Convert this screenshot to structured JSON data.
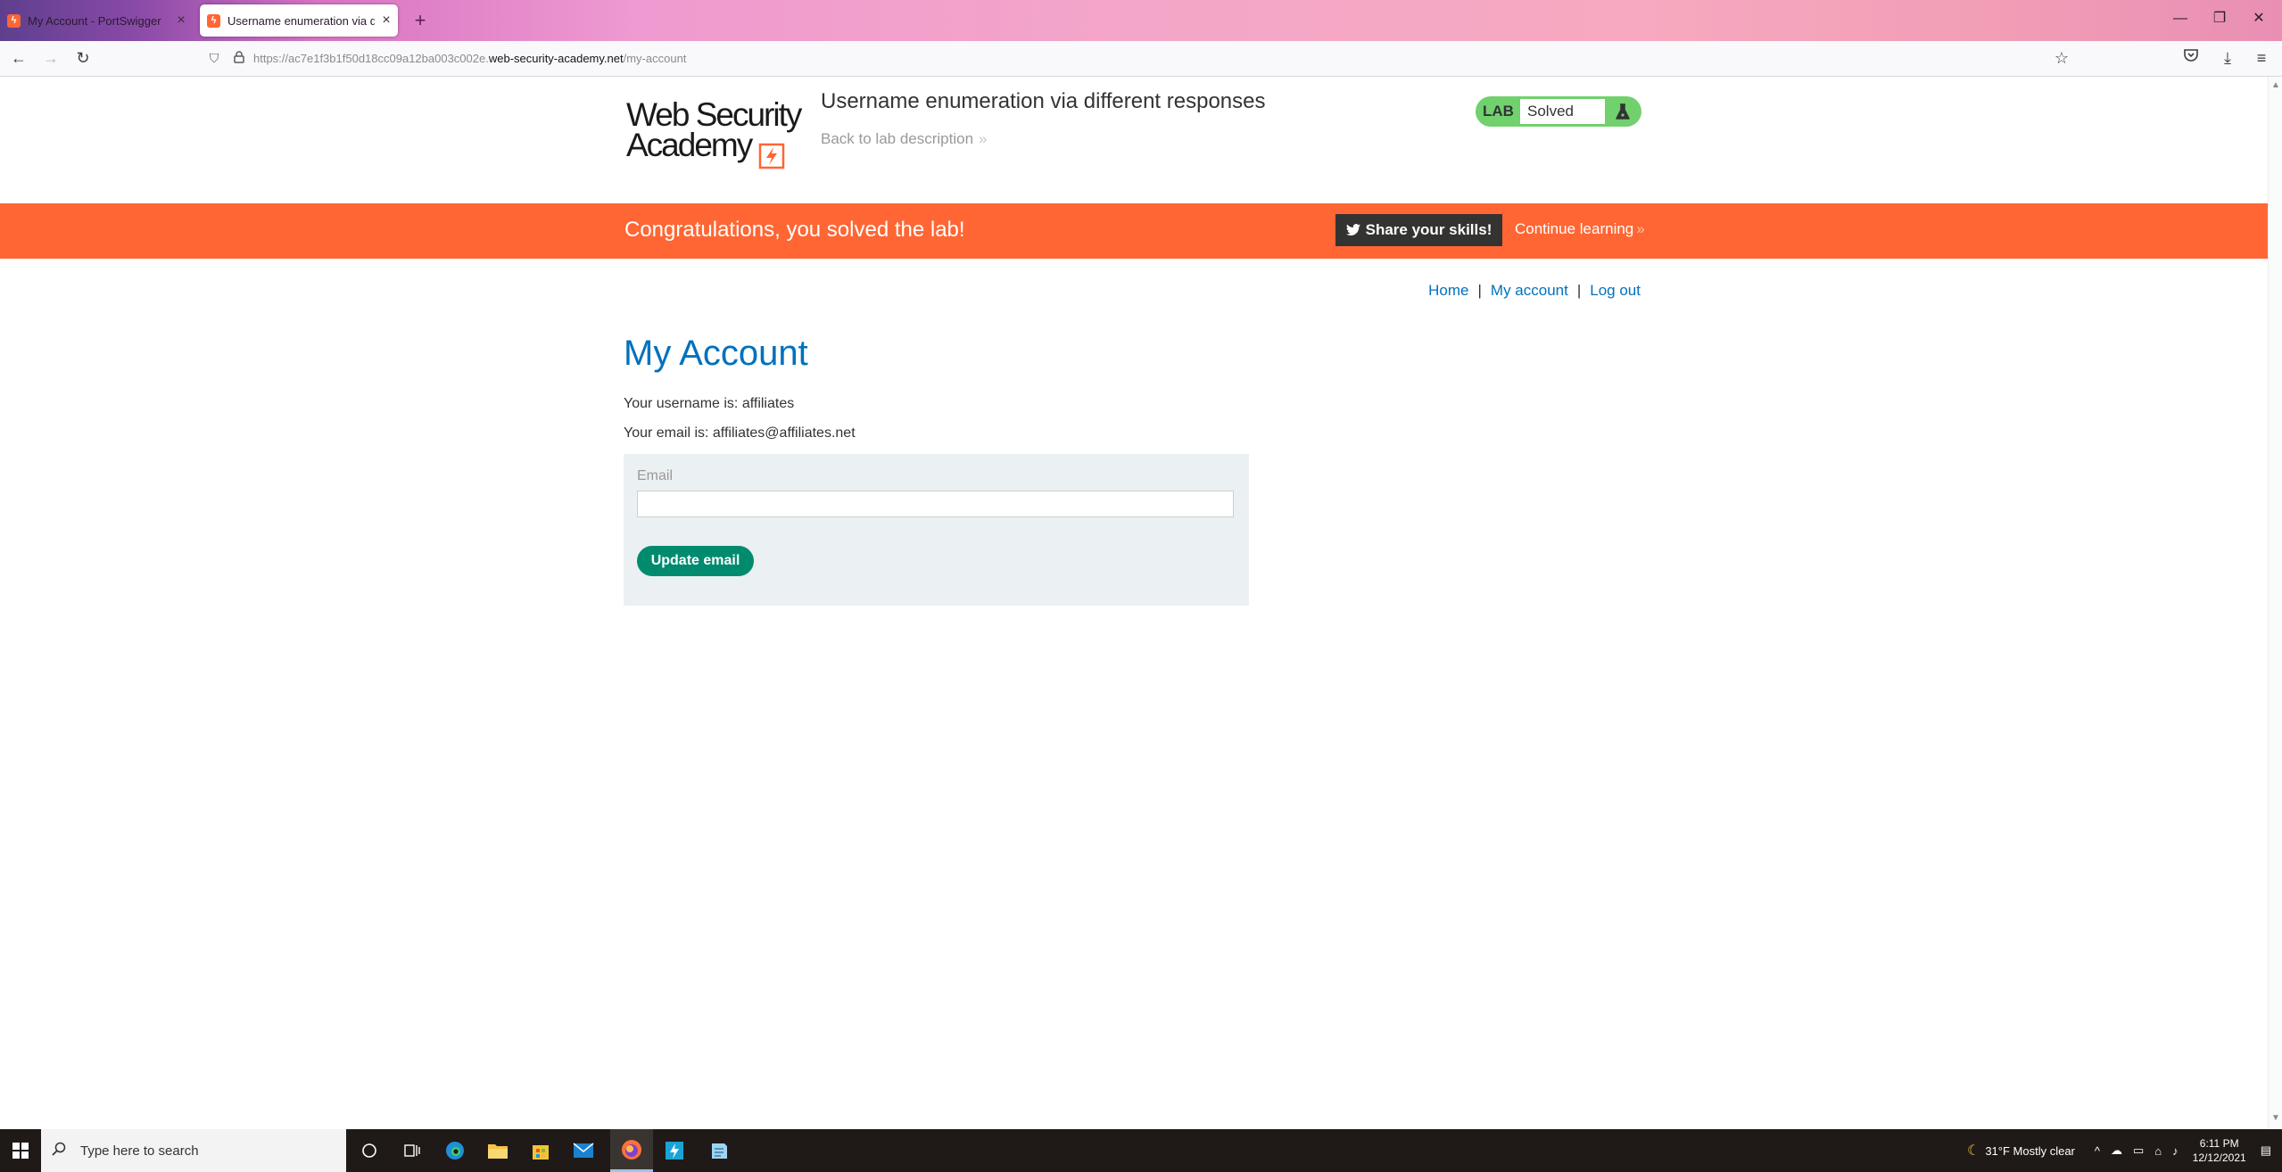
{
  "browser": {
    "tabs": [
      {
        "title": "My Account - PortSwigger",
        "active": false
      },
      {
        "title": "Username enumeration via diffe",
        "active": true
      }
    ],
    "url": {
      "prefix": "https://ac7e1f3b1f50d18cc09a12ba003c002e.",
      "host": "web-security-academy.net",
      "path": "/my-account"
    }
  },
  "header": {
    "logo_line1": "Web Security",
    "logo_line2": "Academy",
    "lab_title": "Username enumeration via different responses",
    "back_link": "Back to lab description",
    "lab_badge": "LAB",
    "lab_status": "Solved"
  },
  "banner": {
    "message": "Congratulations, you solved the lab!",
    "share_label": "Share your skills!",
    "continue_label": "Continue learning"
  },
  "nav": {
    "home": "Home",
    "my_account": "My account",
    "log_out": "Log out",
    "separator": "|"
  },
  "account": {
    "title": "My Account",
    "username_line": "Your username is: affiliates",
    "email_line": "Your email is: affiliates@affiliates.net",
    "email_label": "Email",
    "email_value": "",
    "update_button": "Update email"
  },
  "taskbar": {
    "search_placeholder": "Type here to search",
    "weather": "31°F  Mostly clear",
    "time": "6:11 PM",
    "date": "12/12/2021"
  },
  "colors": {
    "accent_orange": "#ff6633",
    "link_blue": "#0071bc",
    "button_green": "#008b6f",
    "solved_green": "#70d16d"
  }
}
